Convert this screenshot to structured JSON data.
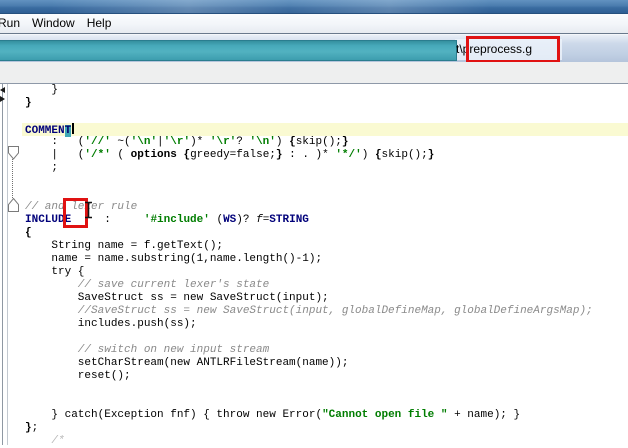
{
  "window": {
    "menu_items": [
      "Run",
      "Window",
      "Help"
    ]
  },
  "toolbar": {
    "path_prefix": "t\\",
    "filename": "preprocess.g"
  },
  "colors": {
    "annotation_red": "#e01212",
    "selection_teal": "#3fa7b7",
    "current_line_yellow": "#fafad2",
    "keyword_navy": "#00007a",
    "string_green": "#007d00",
    "comment_gray": "#8a8a8a",
    "titlebar_blue": "#3a6ba0"
  },
  "editor": {
    "current_line_index": 3,
    "lines": [
      [
        {
          "t": "    }",
          "s": "p"
        }
      ],
      [
        {
          "t": "}",
          "s": "b"
        }
      ],
      [],
      [
        {
          "t": "COMMEN",
          "s": "k"
        },
        {
          "t": "T",
          "s": "ksel"
        },
        {
          "t": "",
          "s": "caret"
        }
      ],
      [
        {
          "t": "    :   (",
          "s": "p"
        },
        {
          "t": "'//'",
          "s": "s"
        },
        {
          "t": " ~(",
          "s": "p"
        },
        {
          "t": "'\\n'",
          "s": "s"
        },
        {
          "t": "|",
          "s": "p"
        },
        {
          "t": "'\\r'",
          "s": "s"
        },
        {
          "t": ")* ",
          "s": "p"
        },
        {
          "t": "'\\r'",
          "s": "s"
        },
        {
          "t": "? ",
          "s": "p"
        },
        {
          "t": "'\\n'",
          "s": "s"
        },
        {
          "t": ") ",
          "s": "p"
        },
        {
          "t": "{",
          "s": "b"
        },
        {
          "t": "skip();",
          "s": "p"
        },
        {
          "t": "}",
          "s": "b"
        }
      ],
      [
        {
          "t": "    |   (",
          "s": "p"
        },
        {
          "t": "'/*'",
          "s": "s"
        },
        {
          "t": " ( ",
          "s": "p"
        },
        {
          "t": "options",
          "s": "b"
        },
        {
          "t": " ",
          "s": "p"
        },
        {
          "t": "{",
          "s": "b"
        },
        {
          "t": "greedy=false;",
          "s": "p"
        },
        {
          "t": "}",
          "s": "b"
        },
        {
          "t": " : . )* ",
          "s": "p"
        },
        {
          "t": "'*/'",
          "s": "s"
        },
        {
          "t": ") ",
          "s": "p"
        },
        {
          "t": "{",
          "s": "b"
        },
        {
          "t": "skip();",
          "s": "p"
        },
        {
          "t": "}",
          "s": "b"
        }
      ],
      [
        {
          "t": "    ;",
          "s": "p"
        }
      ],
      [],
      [],
      [
        {
          "t": "// and lexer rule",
          "s": "c"
        }
      ],
      [
        {
          "t": "INCLUDE",
          "s": "k"
        },
        {
          "t": "     :     ",
          "s": "p"
        },
        {
          "t": "'#include'",
          "s": "s"
        },
        {
          "t": " (",
          "s": "p"
        },
        {
          "t": "WS",
          "s": "k"
        },
        {
          "t": ")? ",
          "s": "p"
        },
        {
          "t": "f",
          "s": "i"
        },
        {
          "t": "=",
          "s": "p"
        },
        {
          "t": "STRING",
          "s": "k"
        }
      ],
      [
        {
          "t": "{",
          "s": "b"
        }
      ],
      [
        {
          "t": "    String name = f.getText();",
          "s": "p"
        }
      ],
      [
        {
          "t": "    name = name.substring(1,name.length()-1);",
          "s": "p"
        }
      ],
      [
        {
          "t": "    try {",
          "s": "p"
        }
      ],
      [
        {
          "t": "        // save current lexer's state",
          "s": "c"
        }
      ],
      [
        {
          "t": "        SaveStruct ss = new SaveStruct(input);",
          "s": "p"
        }
      ],
      [
        {
          "t": "        //SaveStruct ss = new SaveStruct(input, globalDefineMap, globalDefineArgsMap);",
          "s": "c"
        }
      ],
      [
        {
          "t": "        includes.push(ss);",
          "s": "p"
        }
      ],
      [],
      [
        {
          "t": "        // switch on new input stream",
          "s": "c"
        }
      ],
      [
        {
          "t": "        setCharStream(new ANTLRFileStream(name));",
          "s": "p"
        }
      ],
      [
        {
          "t": "        reset();",
          "s": "p"
        }
      ],
      [],
      [],
      [
        {
          "t": "    } catch(Exception fnf) { throw new Error(",
          "s": "p"
        },
        {
          "t": "\"Cannot open file \"",
          "s": "s"
        },
        {
          "t": " + name); }",
          "s": "p"
        }
      ],
      [
        {
          "t": "}",
          "s": "b"
        },
        {
          "t": ";",
          "s": "p"
        }
      ],
      [
        {
          "t": "    /*",
          "s": "cf"
        }
      ]
    ]
  }
}
